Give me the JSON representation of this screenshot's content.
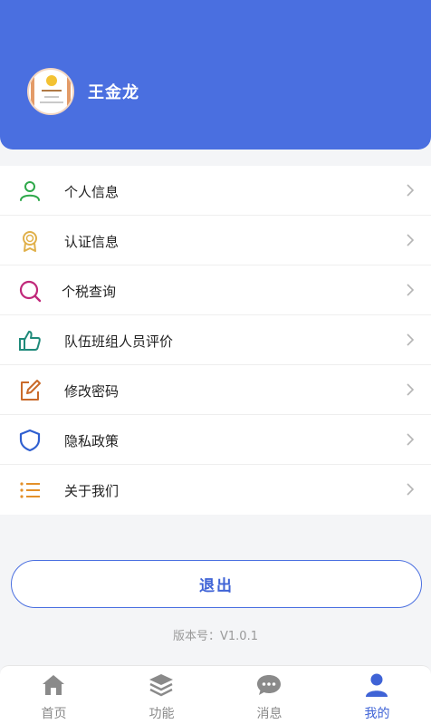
{
  "profile": {
    "name": "王金龙"
  },
  "menu": {
    "items": [
      {
        "label": "个人信息",
        "icon": "person-icon",
        "color": "#2ea84a"
      },
      {
        "label": "认证信息",
        "icon": "certificate-icon",
        "color": "#e0b04a"
      },
      {
        "label": "个税查询",
        "icon": "search-icon",
        "color": "#c0287a"
      },
      {
        "label": "队伍班组人员评价",
        "icon": "thumbs-up-icon",
        "color": "#1f8a7a"
      },
      {
        "label": "修改密码",
        "icon": "edit-icon",
        "color": "#c96a2a"
      },
      {
        "label": "隐私政策",
        "icon": "shield-icon",
        "color": "#2f5fd0"
      },
      {
        "label": "关于我们",
        "icon": "list-icon",
        "color": "#e3902a"
      }
    ]
  },
  "logout": {
    "label": "退出"
  },
  "version": {
    "text": "版本号：V1.0.1"
  },
  "tabbar": {
    "tabs": [
      {
        "label": "首页",
        "icon": "home-icon",
        "active": false
      },
      {
        "label": "功能",
        "icon": "layers-icon",
        "active": false
      },
      {
        "label": "消息",
        "icon": "chat-icon",
        "active": false
      },
      {
        "label": "我的",
        "icon": "user-icon",
        "active": true
      }
    ]
  },
  "colors": {
    "primary": "#4a6fe0",
    "inactive": "#8a8a8a"
  }
}
